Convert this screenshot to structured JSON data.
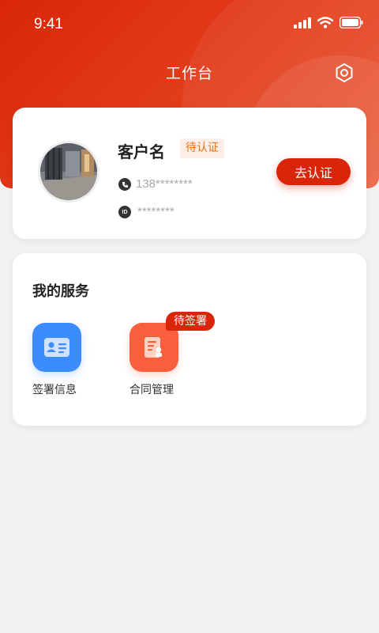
{
  "status_bar": {
    "time": "9:41"
  },
  "header": {
    "title": "工作台"
  },
  "profile": {
    "name": "客户名",
    "status_tag": "待认证",
    "phone": "138********",
    "id_label": "ID",
    "id_number": "********",
    "verify_button": "去认证"
  },
  "services": {
    "title": "我的服务",
    "items": [
      {
        "label": "签署信息",
        "icon": "id-card-icon",
        "color": "#3c8bff"
      },
      {
        "label": "合同管理",
        "icon": "contract-icon",
        "color": "#fa5f3d",
        "badge": "待签署"
      }
    ]
  },
  "colors": {
    "brand": "#d9260b",
    "pending": "#e9731f",
    "blue": "#3c8bff"
  }
}
